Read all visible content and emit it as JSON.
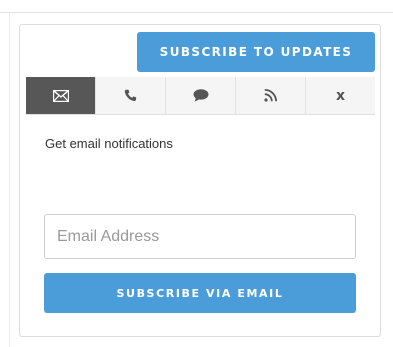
{
  "widget": {
    "header_button_label": "SUBSCRIBE TO UPDATES",
    "tabs": [
      {
        "id": "email",
        "icon": "envelope-icon",
        "active": true
      },
      {
        "id": "sms",
        "icon": "phone-icon",
        "active": false
      },
      {
        "id": "chat",
        "icon": "speech-bubble-icon",
        "active": false
      },
      {
        "id": "rss",
        "icon": "rss-icon",
        "active": false
      },
      {
        "id": "close",
        "icon": "close-icon",
        "label": "x",
        "active": false
      }
    ],
    "email_panel": {
      "description": "Get email notifications",
      "email_placeholder": "Email Address",
      "email_value": "",
      "submit_label": "SUBSCRIBE VIA EMAIL"
    }
  },
  "colors": {
    "accent": "#4a9dd8",
    "active_tab": "#575757",
    "tab_bg": "#f5f5f5"
  }
}
